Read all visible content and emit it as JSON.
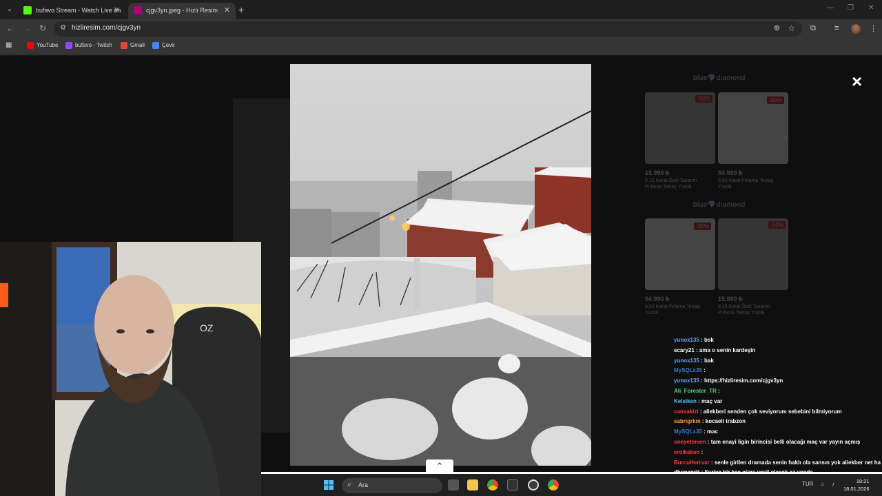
{
  "browser": {
    "tabs": [
      {
        "title": "bufavo Stream - Watch Live on",
        "favicon_color": "#53fc18"
      },
      {
        "title": "cjgv3yn.jpeg - Hızlı Resim",
        "favicon_color": "#b0007a"
      }
    ],
    "url": "hizliresim.com/cjgv3yn",
    "bookmarks": [
      {
        "label": "YouTube",
        "color": "#ff0000"
      },
      {
        "label": "bufavo - Twitch",
        "color": "#9146ff"
      },
      {
        "label": "Gmail",
        "color": "#ea4335"
      },
      {
        "label": "Çevir",
        "color": "#4285f4"
      }
    ]
  },
  "viewer": {
    "close_label": "×",
    "up_arrow": "^"
  },
  "ads": [
    {
      "brand": "blue💎diamond",
      "items": [
        {
          "discount": "-50%",
          "price": "15.990 ₺",
          "desc": "0,15 Karat Özel Tasarım Pırlanta Tektaş Yüzük"
        },
        {
          "discount": "-50%",
          "price": "54.990 ₺",
          "desc": "0,50 Karat Pırlanta Tektaş Yüzük"
        }
      ]
    },
    {
      "brand": "blue💎diamond",
      "items": [
        {
          "discount": "-50%",
          "price": "54.990 ₺",
          "desc": "0,50 Karat Pırlanta Tektaş Yüzük"
        },
        {
          "discount": "-50%",
          "price": "15.990 ₺",
          "desc": "0,15 Karat Özel Tasarım Pırlanta Tektaş Yüzük"
        }
      ]
    }
  ],
  "chat": [
    {
      "user": "yunox135",
      "color": "#5ea3ff",
      "msg": ": bsk"
    },
    {
      "user": "scary21",
      "color": "#ffffff",
      "msg": ": ama o senin kardeşin"
    },
    {
      "user": "yunox135",
      "color": "#5ea3ff",
      "msg": ": bak"
    },
    {
      "user": "MySQLx35",
      "color": "#3a7bd5",
      "msg": ":"
    },
    {
      "user": "yunox135",
      "color": "#5ea3ff",
      "msg": ": https://hizliresim.com/cjgv3yn"
    },
    {
      "user": "Ali_Forester_TR",
      "color": "#56d672",
      "msg": ":"
    },
    {
      "user": "Kelsiken",
      "color": "#4fc3f7",
      "msg": ": maç var"
    },
    {
      "user": "cansakizi",
      "color": "#ff3b3b",
      "msg": ": aliekberi senden çok seviyorum sebebini bilmiyorum"
    },
    {
      "user": "sabrigrkm",
      "color": "#ff9a3c",
      "msg": ": kocaeli trabzon"
    },
    {
      "user": "MySQLx35",
      "color": "#3a7bd5",
      "msg": ": mac"
    },
    {
      "user": "oneyetenem",
      "color": "#ff3b3b",
      "msg": ": tam enayi ligin birincisi belli olacağı maç var yayın açmış"
    },
    {
      "user": "erolkeken",
      "color": "#ff3b3b",
      "msg": ":"
    },
    {
      "user": "BurcuHerrvar",
      "color": "#ff3b3b",
      "msg": ": senle girilen dramada senin haklı ola sansın yok aliekber net haklıdı"
    },
    {
      "user": "dbonaprtt",
      "color": "#ffffff",
      "msg": ": Suriye bir kac güne yeşil olacak az yoode"
    }
  ],
  "taskbar": {
    "search_label": "Ara",
    "lang": "TUR",
    "time": "18:21",
    "date": "18.01.2026"
  }
}
